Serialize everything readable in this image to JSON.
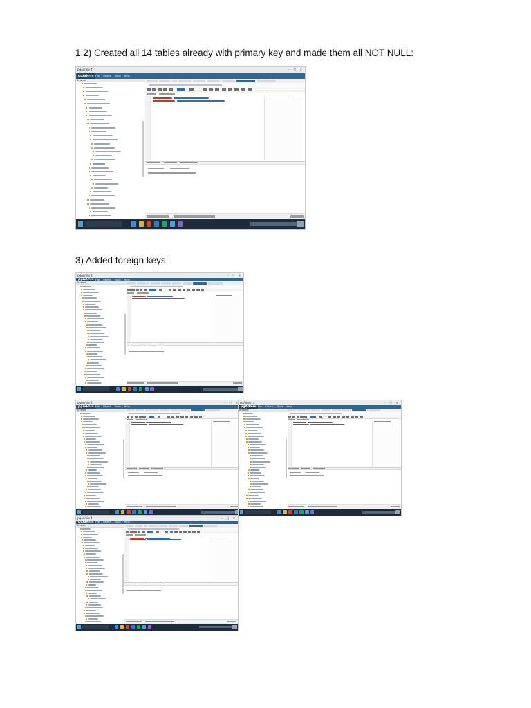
{
  "document": {
    "heading1": "1,2) Created all 14 tables already with primary key and made them all NOT NULL:",
    "heading2": "3) Added foreign keys:"
  },
  "screenshots": [
    {
      "id": "tables-created",
      "window_title": "pgAdmin 4",
      "logo": "pgAdmin",
      "menus": [
        "File",
        "Object",
        "Tools",
        "Help"
      ],
      "browser_label": "Browser"
    },
    {
      "id": "fk-1",
      "window_title": "pgAdmin 4",
      "logo": "pgAdmin",
      "menus": [
        "File",
        "Object",
        "Tools",
        "Help"
      ],
      "browser_label": "Browser"
    },
    {
      "id": "fk-2",
      "window_title": "pgAdmin 4",
      "logo": "pgAdmin",
      "menus": [
        "File",
        "Object",
        "Tools",
        "Help"
      ],
      "browser_label": "Browser"
    },
    {
      "id": "fk-3",
      "window_title": "pgAdmin 4",
      "logo": "pgAdmin",
      "menus": [
        "File",
        "Object",
        "Tools",
        "Help"
      ],
      "browser_label": "Browser"
    },
    {
      "id": "fk-4",
      "window_title": "pgAdmin 4",
      "logo": "pgAdmin",
      "menus": [
        "File",
        "Object",
        "Tools",
        "Help"
      ],
      "browser_label": "Browser"
    }
  ],
  "colors": {
    "pgadmin_blue": "#326690",
    "taskbar": "#1d2b3a",
    "sql_keyword": "#c0392b",
    "sql_text": "#2f6fb1"
  }
}
